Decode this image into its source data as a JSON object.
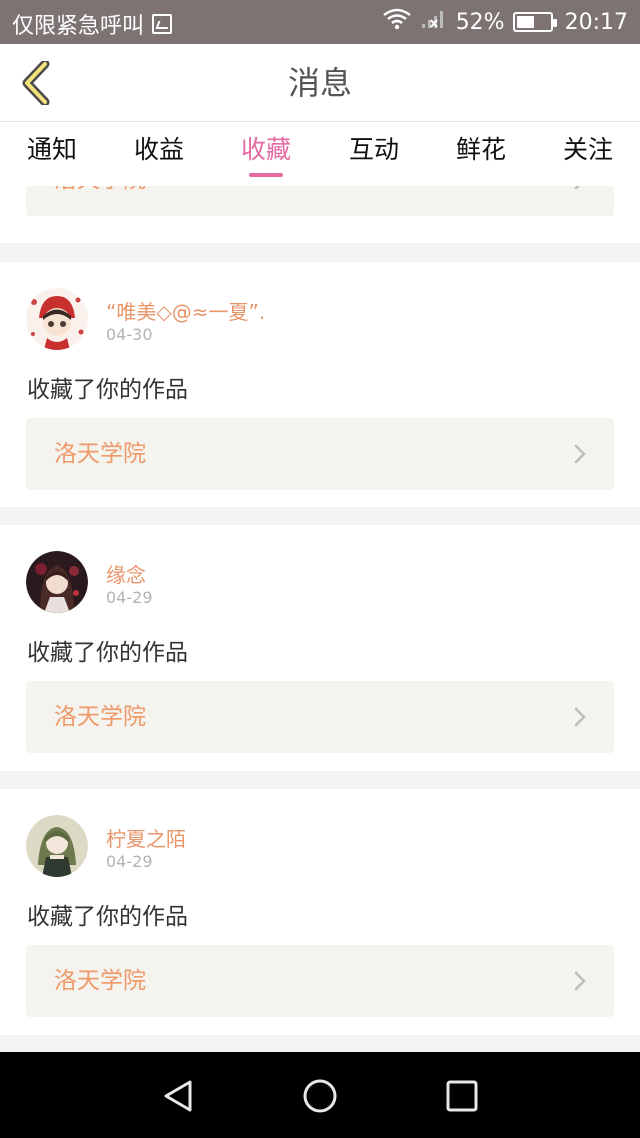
{
  "status_bar": {
    "carrier_text": "仅限紧急呼叫",
    "battery_percent": "52%",
    "battery_level": 0.52,
    "time": "20:17",
    "icons": [
      "picture-icon",
      "wifi-icon",
      "no-signal-icon",
      "battery-icon"
    ]
  },
  "header": {
    "title": "消息",
    "back_icon": "chevron-left-icon"
  },
  "tabs": [
    {
      "label": "通知",
      "active": false
    },
    {
      "label": "收益",
      "active": false
    },
    {
      "label": "收藏",
      "active": true
    },
    {
      "label": "互动",
      "active": false
    },
    {
      "label": "鲜花",
      "active": false
    },
    {
      "label": "关注",
      "active": false
    }
  ],
  "colors": {
    "accent": "#e56aa2",
    "username": "#e8956a",
    "work_title": "#ee9a6a",
    "status_bar": "#7d7373"
  },
  "partial_card": {
    "work_title": "洛天学院"
  },
  "notifications": [
    {
      "username": "“唯美◇@≈一夏”.",
      "date": "04-30",
      "action": "收藏了你的作品",
      "work_title": "洛天学院"
    },
    {
      "username": "缘念",
      "date": "04-29",
      "action": "收藏了你的作品",
      "work_title": "洛天学院"
    },
    {
      "username": "柠夏之陌",
      "date": "04-29",
      "action": "收藏了你的作品",
      "work_title": "洛天学院"
    }
  ],
  "nav_bar": {
    "icons": [
      "back-triangle-icon",
      "home-circle-icon",
      "recents-square-icon"
    ]
  }
}
